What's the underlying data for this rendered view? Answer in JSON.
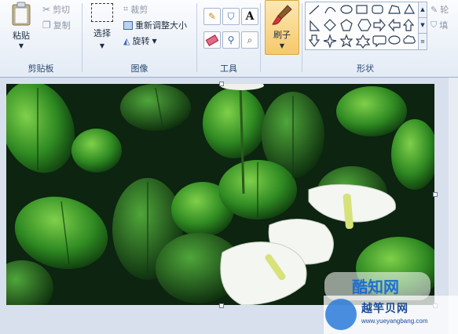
{
  "clipboard": {
    "paste_label": "粘贴",
    "cut_label": "剪切",
    "copy_label": "复制",
    "group_label": "剪贴板"
  },
  "image": {
    "select_label": "选择",
    "crop_label": "裁剪",
    "resize_label": "重新调整大小",
    "rotate_label": "旋转",
    "group_label": "图像"
  },
  "tools": {
    "group_label": "工具",
    "text_tool": "A"
  },
  "brushes": {
    "label": "刷子"
  },
  "shapes": {
    "group_label": "形状",
    "outline_label": "轮",
    "fill_label": "填"
  },
  "watermark": {
    "text": "酷知网",
    "site_name": "越竿贝网",
    "url": "www.yueyangbang.com"
  },
  "colors": {
    "accent": "#f6c86b",
    "ribbon_text": "#1e395b",
    "canvas_bg": "#d7e0ec"
  }
}
